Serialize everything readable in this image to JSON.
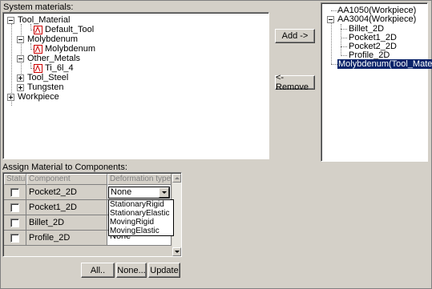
{
  "system_materials": {
    "label": "System materials:",
    "tree": {
      "tool_material": "Tool_Material",
      "default_tool": "Default_Tool",
      "molybdenum_group": "Molybdenum",
      "molybdenum_item": "Molybdenum",
      "other_metals": "Other_Metals",
      "ti_6l_4": "Ti_6l_4",
      "tool_steel": "Tool_Steel",
      "tungsten": "Tungsten",
      "workpiece": "Workpiece"
    }
  },
  "transfer": {
    "add_label": "Add ->",
    "remove_label": "<- Remove"
  },
  "assigned_tree": {
    "aa1050": "AA1050(Workpiece)",
    "aa3004": "AA3004(Workpiece)",
    "billet_2d": "Billet_2D",
    "pocket1_2d": "Pocket1_2D",
    "pocket2_2d": "Pocket2_2D",
    "profile_2d": "Profile_2D",
    "molybdenum_tool": "Molybdenum(Tool_Material)"
  },
  "assign": {
    "label": "Assign Material to Components:",
    "columns": [
      "Status",
      "Component",
      "Deformation type"
    ],
    "rows": [
      {
        "component": "Pocket2_2D",
        "deformation": "None"
      },
      {
        "component": "Pocket1_2D",
        "deformation": ""
      },
      {
        "component": "Billet_2D",
        "deformation": ""
      },
      {
        "component": "Profile_2D",
        "deformation": "None"
      }
    ],
    "dropdown_options": [
      "StationaryRigid",
      "StationaryElastic",
      "MovingRigid",
      "MovingElastic"
    ]
  },
  "buttons": {
    "all_label": "All..",
    "none_label": "None...",
    "update_label": "Update"
  },
  "colors": {
    "window_bg": "#d4d0c8",
    "selection_bg": "#0a246a",
    "material_icon": "#cc0000"
  }
}
